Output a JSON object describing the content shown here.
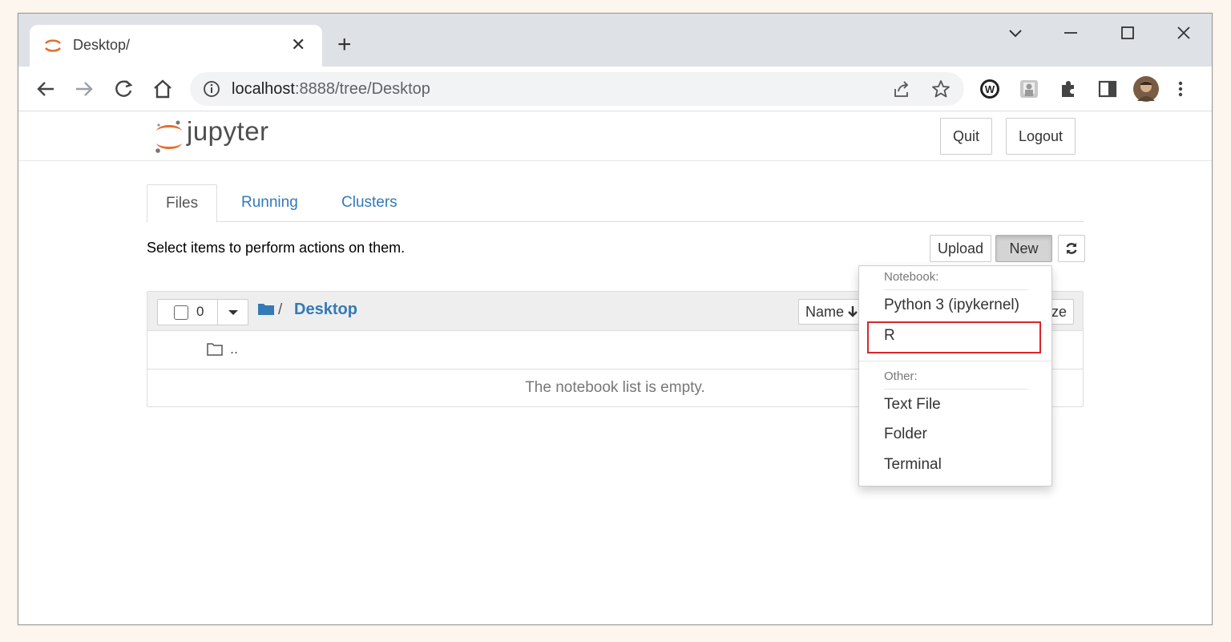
{
  "browser": {
    "tab_title": "Desktop/",
    "url_host": "localhost",
    "url_rest": ":8888/tree/Desktop"
  },
  "header": {
    "logo_text": "jupyter",
    "quit_label": "Quit",
    "logout_label": "Logout"
  },
  "tabs": [
    {
      "label": "Files"
    },
    {
      "label": "Running"
    },
    {
      "label": "Clusters"
    }
  ],
  "toolbar": {
    "hint": "Select items to perform actions on them.",
    "upload_label": "Upload",
    "new_label": "New"
  },
  "list": {
    "selected_count": "0",
    "breadcrumb_sep": "/",
    "breadcrumb_folder": "Desktop",
    "sort_name_label": "Name",
    "sort_size_label": "ze",
    "parent_dir": "..",
    "empty_message": "The notebook list is empty."
  },
  "new_menu": {
    "notebook_header": "Notebook:",
    "notebook_items": [
      "Python 3 (ipykernel)",
      "R"
    ],
    "other_header": "Other:",
    "other_items": [
      "Text File",
      "Folder",
      "Terminal"
    ]
  },
  "colors": {
    "link_blue": "#337ab7",
    "jupyter_orange": "#e46e2e",
    "highlight_red": "#d9262b"
  }
}
